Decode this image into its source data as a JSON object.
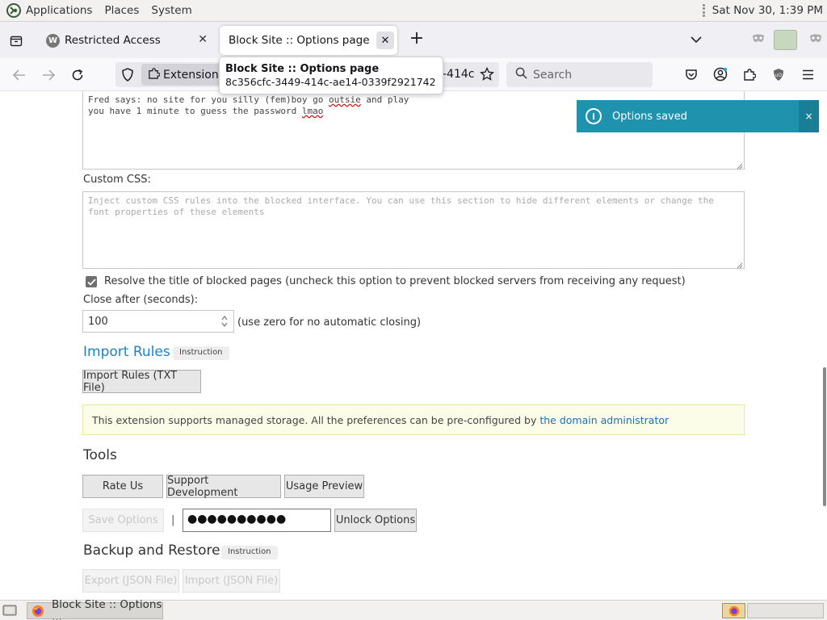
{
  "top_panel": {
    "menus": [
      "Applications",
      "Places",
      "System"
    ],
    "clock": "Sat Nov 30,  1:39 PM"
  },
  "tabs": [
    {
      "title": "Restricted Access",
      "favicon_letter": "W"
    },
    {
      "title": "Block Site :: Options page"
    }
  ],
  "tooltip": {
    "title": "Block Site :: Options page",
    "subtitle": "8c356cfc-3449-414c-ae14-0339f2921742"
  },
  "nav": {
    "extension_chip": "Extension (",
    "url_fragment": "-414c",
    "search_placeholder": "Search"
  },
  "content": {
    "message_text_line1": "Fred says: no site for you silly (fem)boy go ",
    "message_text_word1": "outsie",
    "message_text_line1_end": " and play",
    "message_text_line2": "you have 1 minute to guess the password ",
    "message_text_word2": "lmao",
    "custom_css_label": "Custom CSS:",
    "custom_css_placeholder": "Inject custom CSS rules into the blocked interface. You can use this section to hide different elements or change the font properties of these elements",
    "resolve_label": "Resolve the title of blocked pages (uncheck this option to prevent blocked servers from receiving any request)",
    "close_after_label": "Close after (seconds):",
    "close_after_value": "100",
    "close_after_hint": "(use zero for no automatic closing)",
    "import_rules_heading": "Import Rules",
    "instruction_badge": "Instruction",
    "import_rules_button": "Import Rules (TXT File)",
    "managed_note": "This extension supports managed storage. All the preferences can be pre-configured by ",
    "managed_link": "the domain administrator",
    "tools_heading": "Tools",
    "rate_button": "Rate Us",
    "support_button": "Support Development",
    "usage_button": "Usage Preview",
    "save_button": "Save Options",
    "separator": "|",
    "password_value": "●●●●●●●●●●",
    "unlock_button": "Unlock Options",
    "backup_heading": "Backup and Restore",
    "export_button": "Export (JSON File)",
    "import_json_button": "Import (JSON File)"
  },
  "notification": {
    "message": "Options saved",
    "close": "×"
  },
  "taskbar": {
    "task_title": "Block Site :: Options ..."
  },
  "colors": {
    "link": "#1b82c7",
    "notification_bg": "#1f92ad"
  }
}
